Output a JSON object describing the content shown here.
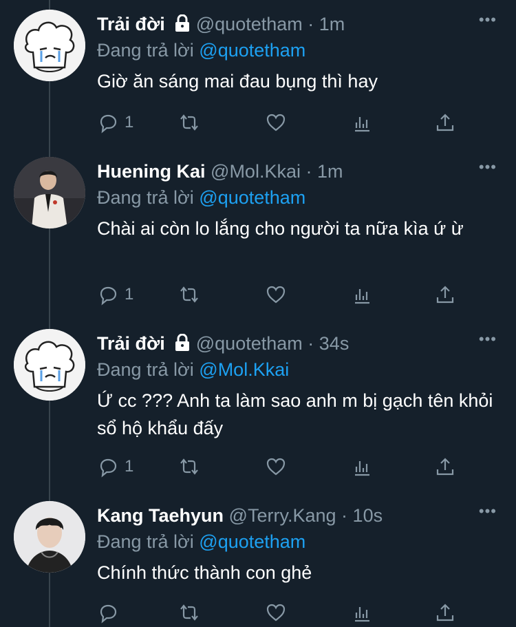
{
  "tweets": [
    {
      "name": "Trải đời",
      "locked": true,
      "handle": "@quotetham",
      "time": "1m",
      "reply_prefix": "Đang trả lời",
      "reply_to": "@quotetham",
      "text": "Giờ ăn sáng mai đau bụng thì hay",
      "reply_count": "1",
      "avatar": "cartoon-chef-avatar"
    },
    {
      "name": "Huening Kai",
      "locked": false,
      "handle": "@Mol.Kkai",
      "time": "1m",
      "reply_prefix": "Đang trả lời",
      "reply_to": "@quotetham",
      "text": "Chài ai còn lo lắng cho người ta nữa kìa ứ ừ",
      "reply_count": "1",
      "avatar": "person-photo-avatar"
    },
    {
      "name": "Trải đời",
      "locked": true,
      "handle": "@quotetham",
      "time": "34s",
      "reply_prefix": "Đang trả lời",
      "reply_to": "@Mol.Kkai",
      "text": "Ứ cc ??? Anh ta làm sao anh m bị gạch tên khỏi sổ hộ khẩu đấy",
      "reply_count": "1",
      "avatar": "cartoon-chef-avatar"
    },
    {
      "name": "Kang Taehyun",
      "locked": false,
      "handle": "@Terry.Kang",
      "time": "10s",
      "reply_prefix": "Đang trả lời",
      "reply_to": "@quotetham",
      "text": "Chính thức thành con ghẻ",
      "reply_count": "",
      "avatar": "person-photo-avatar"
    }
  ],
  "ui": {
    "more_glyph": "•••",
    "separator": "·"
  },
  "colors": {
    "background": "#15202b",
    "text": "#ffffff",
    "muted": "#8899a6",
    "accent": "#1da1f2",
    "thread_line": "#38444d"
  },
  "icons": [
    "reply-icon",
    "retweet-icon",
    "like-icon",
    "analytics-icon",
    "share-icon",
    "lock-icon",
    "more-icon"
  ]
}
